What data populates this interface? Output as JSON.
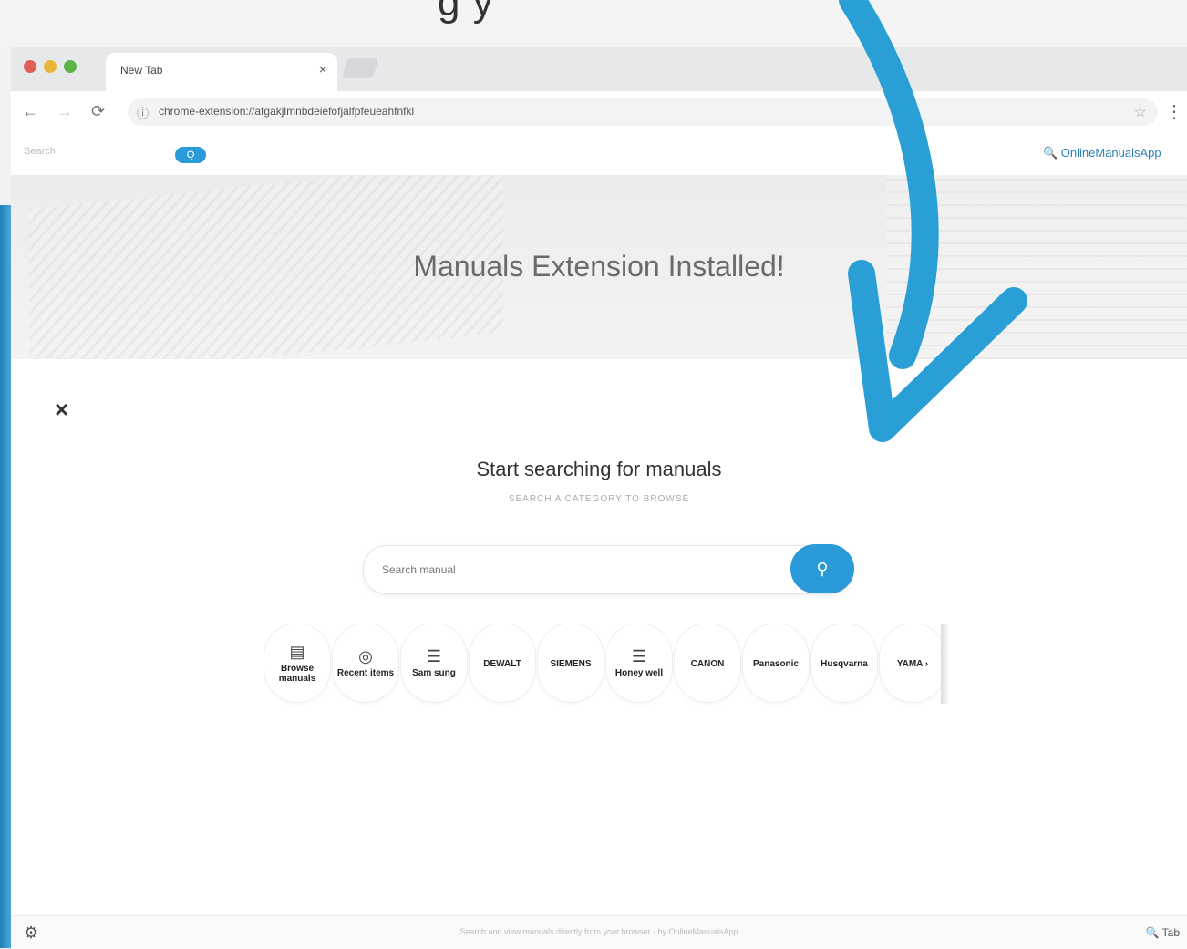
{
  "header_text": "g y",
  "browser": {
    "tab_title": "New Tab",
    "tab_close": "×",
    "url": "chrome-extension://afgakjlmnbdeiefofjalfpfeueahfnfkl",
    "back_icon": "←",
    "forward_icon": "→",
    "reload_icon": "⟳",
    "menu_icon": "⋮",
    "star_icon": "☆",
    "secure_icon": "ⓘ"
  },
  "extension_bar": {
    "left_text": "Search",
    "pill_label": "Q",
    "right_text": "🔍 OnlineManualsApp"
  },
  "hero": {
    "title": "Manuals Extension Installed!"
  },
  "main": {
    "close_label": "×",
    "heading": "Start searching for manuals",
    "subheading": "SEARCH A CATEGORY TO BROWSE",
    "search_placeholder": "Search manual",
    "search_button_icon": "⚲",
    "categories": [
      {
        "icon": "▤",
        "label": "Browse manuals"
      },
      {
        "icon": "◎",
        "label": "Recent items"
      },
      {
        "icon": "☰",
        "label": "Sam sung"
      },
      {
        "icon": "",
        "label": "DEWALT"
      },
      {
        "icon": "",
        "label": "SIEMENS"
      },
      {
        "icon": "☰",
        "label": "Honey well"
      },
      {
        "icon": "",
        "label": "CANON"
      },
      {
        "icon": "",
        "label": "Panasonic"
      },
      {
        "icon": "",
        "label": "Husqvarna"
      },
      {
        "icon": "",
        "label": "YAMA ›"
      }
    ]
  },
  "footer": {
    "left_icon": "⚙",
    "center_text": "Search and view manuals directly from your browser - by OnlineManualsApp",
    "right_text": "🔍 Tab"
  },
  "colors": {
    "accent_blue": "#2b9ad8",
    "arrow_blue": "#2a9fd6"
  }
}
